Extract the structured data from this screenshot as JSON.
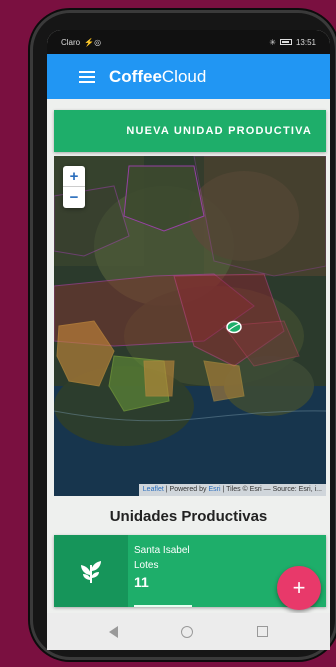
{
  "status": {
    "carrier": "Claro",
    "carrier_extra": "⚡◎",
    "time": "13:51",
    "bt": "✳"
  },
  "appbar": {
    "brand_bold": "Coffee",
    "brand_rest": "Cloud",
    "menu_icon": "hamburger-menu-icon"
  },
  "actions": {
    "new_unit": "NUEVA UNIDAD PRODUCTIVA"
  },
  "map": {
    "zoom_in": "+",
    "zoom_out": "−",
    "attr_leaflet": "Leaflet",
    "attr_powered": " | Powered by ",
    "attr_esri": "Esri",
    "attr_rest": " | Tiles © Esri — Source: Esri, i...",
    "marker_icon": "coffee-bean-icon"
  },
  "units": {
    "title": "Unidades Productivas",
    "items": [
      {
        "name": "Santa Isabel",
        "label": "Lotes",
        "count": "11",
        "icon": "plant-sprout-icon"
      }
    ]
  },
  "fab": {
    "label": "+"
  },
  "colors": {
    "primary": "#2196f3",
    "green": "#1eae6a",
    "fab": "#e8396a"
  }
}
